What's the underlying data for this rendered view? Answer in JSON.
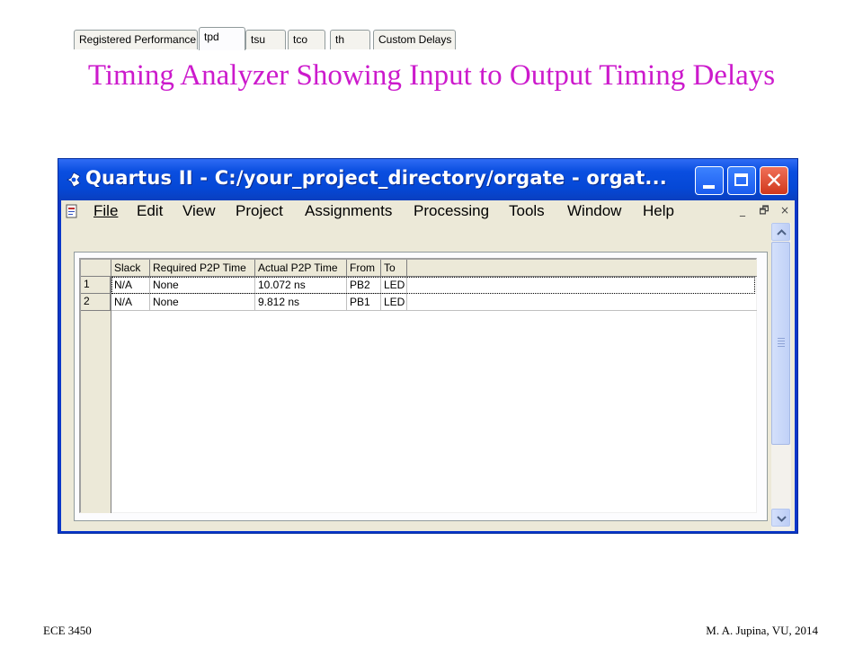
{
  "slide": {
    "title": "Timing Analyzer Showing Input to Output Timing Delays",
    "footer_left": "ECE 3450",
    "footer_right": "M. A. Jupina, VU, 2014",
    "title_color": "#cc1acc"
  },
  "window": {
    "title": "Quartus II - C:/your_project_directory/orgate - orgat...",
    "titlebar_color": "#0548d6",
    "controls": {
      "minimize": "minimize-icon",
      "maximize": "maximize-icon",
      "close": "close-icon"
    }
  },
  "menu": {
    "items": [
      "File",
      "Edit",
      "View",
      "Project",
      "Assignments",
      "Processing",
      "Tools",
      "Window",
      "Help"
    ],
    "mdi_controls": [
      "_",
      "🗗",
      "×"
    ]
  },
  "tabs": {
    "items": [
      "Registered Performance",
      "tpd",
      "tsu",
      "tco",
      "th",
      "Custom Delays"
    ],
    "active": "tpd"
  },
  "table": {
    "columns": [
      "Slack",
      "Required P2P Time",
      "Actual P2P Time",
      "From",
      "To"
    ],
    "rows": [
      {
        "num": "1",
        "slack": "N/A",
        "required": "None",
        "actual": "10.072 ns",
        "from": "PB2",
        "to": "LED"
      },
      {
        "num": "2",
        "slack": "N/A",
        "required": "None",
        "actual": "9.812 ns",
        "from": "PB1",
        "to": "LED"
      }
    ]
  }
}
